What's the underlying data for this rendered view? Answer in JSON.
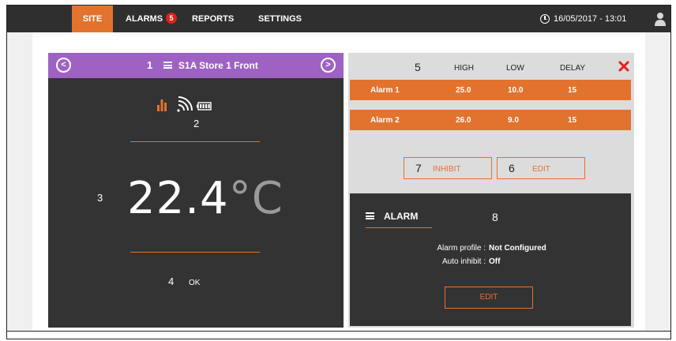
{
  "nav": {
    "site": "SITE",
    "alarms": "ALARMS",
    "alarms_badge": "5",
    "reports": "REPORTS",
    "settings": "SETTINGS",
    "datetime": "16/05/2017 - 13:01"
  },
  "sensor": {
    "index_1": "1",
    "title": "S1A Store 1 Front",
    "index_2": "2",
    "index_3": "3",
    "temperature": "22.4",
    "unit": "°C",
    "index_4": "4",
    "status": "OK"
  },
  "alarms": {
    "index_5": "5",
    "headers": {
      "high": "HIGH",
      "low": "LOW",
      "delay": "DELAY"
    },
    "rows": [
      {
        "name": "Alarm 1",
        "high": "25.0",
        "low": "10.0",
        "delay": "15"
      },
      {
        "name": "Alarm 2",
        "high": "26.0",
        "low": "9.0",
        "delay": "15"
      }
    ],
    "inhibit_index": "7",
    "inhibit_label": "INHIBIT",
    "edit_index": "6",
    "edit_label": "EDIT"
  },
  "alarm_card": {
    "tab_label": "ALARM",
    "index_8": "8",
    "profile_label": "Alarm profile :",
    "profile_value": "Not Configured",
    "auto_inhibit_label": "Auto inhibit :",
    "auto_inhibit_value": "Off",
    "edit_label": "EDIT"
  },
  "colors": {
    "accent": "#e2732e",
    "header_purple": "#9e63c2",
    "panel_dark": "#333333",
    "badge_red": "#d9211c"
  },
  "icons": [
    "chevron-left-icon",
    "chevron-right-icon",
    "menu-icon",
    "bar-chart-icon",
    "wifi-signal-icon",
    "battery-icon",
    "clock-icon",
    "user-icon",
    "close-icon"
  ]
}
